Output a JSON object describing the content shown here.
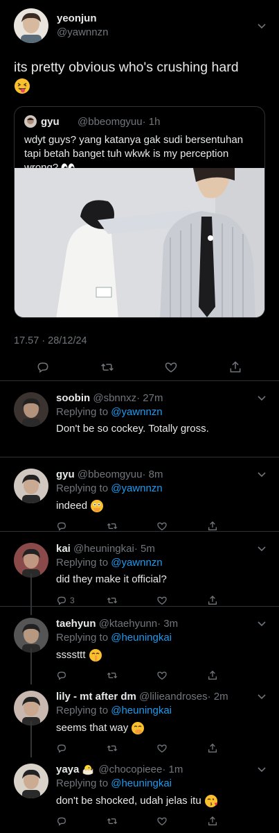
{
  "main_tweet": {
    "name": "yeonjun",
    "handle": "@yawnnzn",
    "text": "its pretty obvious who's crushing hard",
    "emoji": "squinting-face-with-tongue",
    "quote": {
      "name": "gyu",
      "handle": "@bbeomgyuu",
      "time": "· 1h",
      "text": "wdyt guys? yang katanya gak sudi bersentuhan tapi betah banget tuh wkwk is my perception wrong?",
      "emoji": "eyes"
    },
    "timestamp": "17.57 · 28/12/24",
    "actions": [
      "reply",
      "retweet",
      "like",
      "share"
    ]
  },
  "replies": [
    {
      "name": "soobin",
      "handle": "@sbnnxz",
      "time": "· 27m",
      "replying_label": "Replying to",
      "replying_to": "@yawnnzn",
      "text": "Don't be so cockey. Totally gross.",
      "emoji": "",
      "reply_count": "",
      "avatar_color": "#3a3330"
    },
    {
      "name": "gyu",
      "handle": "@bbeomgyuu",
      "time": "· 8m",
      "replying_label": "Replying to",
      "replying_to": "@yawnnzn",
      "text": "indeed",
      "emoji": "face-with-open-eyes-hand-over-mouth",
      "reply_count": "",
      "avatar_color": "#cfc7c0"
    },
    {
      "name": "kai",
      "handle": "@heuningkai",
      "time": "· 5m",
      "replying_label": "Replying to",
      "replying_to": "@yawnnzn",
      "text": "did they make it official?",
      "emoji": "",
      "reply_count": "3",
      "avatar_color": "#8a4a4a"
    },
    {
      "name": "taehyun",
      "handle": "@ktaehyunn",
      "time": "· 3m",
      "replying_label": "Replying to",
      "replying_to": "@heuningkai",
      "text": "ssssttt",
      "emoji": "shushing-face",
      "reply_count": "",
      "avatar_color": "#555555"
    },
    {
      "name": "lily - mt after dm",
      "handle": "@lilieandroses",
      "time": "· 2m",
      "replying_label": "Replying to",
      "replying_to": "@heuningkai",
      "text": "seems that way",
      "emoji": "face-with-hand-over-mouth",
      "reply_count": "",
      "avatar_color": "#c9b8b0"
    },
    {
      "name": "yaya",
      "handle": "@chocopieee",
      "time": "· 1m",
      "replying_label": "Replying to",
      "replying_to": "@heuningkai",
      "text": "don't be shocked, udah jelas itu",
      "emoji": "face-blowing-a-kiss",
      "name_emoji": "hatching-chick",
      "reply_count": "",
      "avatar_color": "#d9d2c8"
    }
  ],
  "colors": {
    "background": "#000000",
    "text": "#e7e9ea",
    "muted": "#71767b",
    "link": "#1d9bf0",
    "divider": "#2f3336"
  }
}
